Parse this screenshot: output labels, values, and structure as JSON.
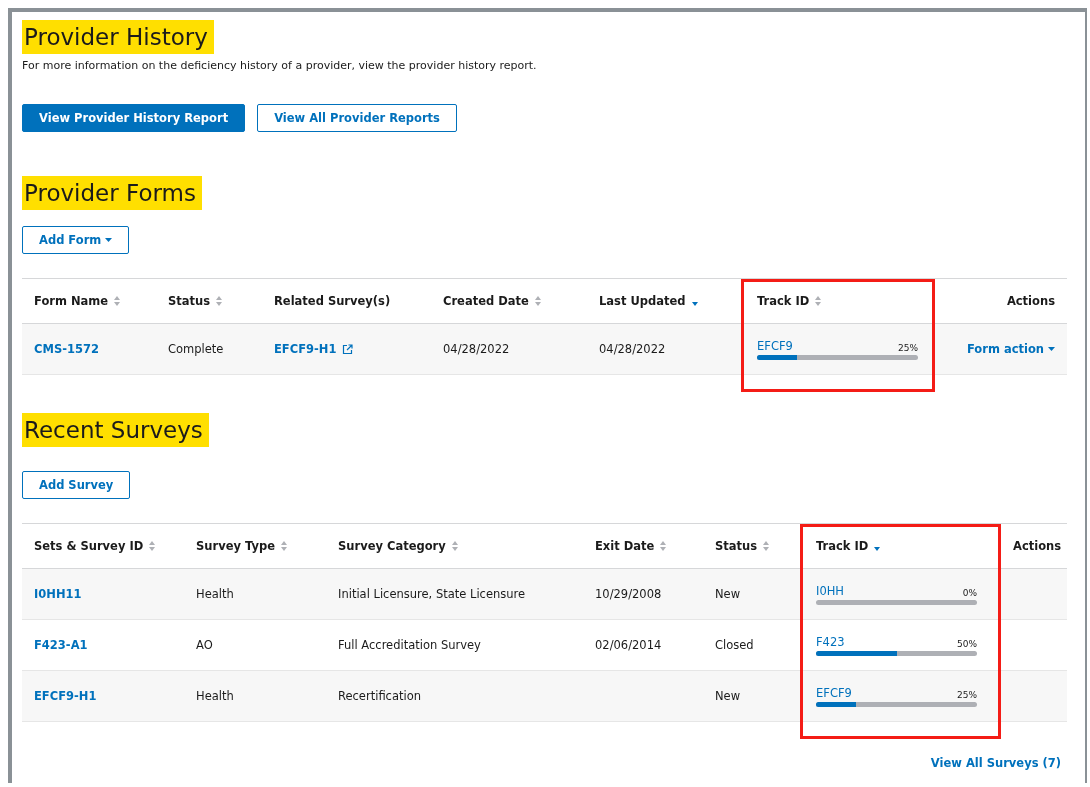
{
  "provider_history": {
    "title": "Provider History",
    "description": "For more information on the deficiency history of a provider, view the provider history report.",
    "buttons": [
      {
        "label": "View Provider History Report",
        "kind": "primary"
      },
      {
        "label": "View All Provider Reports",
        "kind": "outline"
      }
    ]
  },
  "provider_forms": {
    "title": "Provider Forms",
    "add_button": {
      "label": "Add Form",
      "dropdown": true
    },
    "columns": [
      {
        "label": "Form Name",
        "sortable": true,
        "sorted_descending": false,
        "highlighted": false
      },
      {
        "label": "Status",
        "sortable": true,
        "sorted_descending": false,
        "highlighted": false
      },
      {
        "label": "Related Survey(s)",
        "sortable": false,
        "highlighted": false
      },
      {
        "label": "Created Date",
        "sortable": true,
        "sorted_descending": false,
        "highlighted": false
      },
      {
        "label": "Last Updated",
        "sortable": true,
        "sorted_descending": true,
        "highlighted": false
      },
      {
        "label": "Track ID",
        "sortable": true,
        "sorted_descending": false,
        "highlighted": true
      },
      {
        "label": "Actions",
        "sortable": false,
        "highlighted": false
      }
    ],
    "rows": [
      {
        "form_name": "CMS-1572",
        "status": "Complete",
        "related_survey": "EFCF9-H1",
        "created_date": "04/28/2022",
        "last_updated": "04/28/2022",
        "track_id": "EFCF9",
        "progress": "25%",
        "level": 0.25,
        "action": "Form action"
      }
    ]
  },
  "recent_surveys": {
    "title": "Recent Surveys",
    "add_button": {
      "label": "Add Survey",
      "dropdown": false
    },
    "columns": [
      {
        "label": "Sets & Survey ID",
        "sortable": true,
        "sorted_descending": false,
        "highlighted": false
      },
      {
        "label": "Survey Type",
        "sortable": true,
        "sorted_descending": false,
        "highlighted": false
      },
      {
        "label": "Survey Category",
        "sortable": true,
        "sorted_descending": false,
        "highlighted": false
      },
      {
        "label": "Exit Date",
        "sortable": true,
        "sorted_descending": false,
        "highlighted": false
      },
      {
        "label": "Status",
        "sortable": true,
        "sorted_descending": false,
        "highlighted": false
      },
      {
        "label": "Track ID",
        "sortable": true,
        "sorted_descending": true,
        "highlighted": true
      },
      {
        "label": "Actions",
        "sortable": false,
        "highlighted": false
      }
    ],
    "rows": [
      {
        "survey_id": "I0HH11",
        "survey_type": "Health",
        "survey_category": "Initial Licensure, State Licensure",
        "exit_date": "10/29/2008",
        "status": "New",
        "track_id": "I0HH",
        "progress": "0%"
      },
      {
        "survey_id": "F423-A1",
        "survey_type": "AO",
        "survey_category": "Full Accreditation Survey",
        "exit_date": "02/06/2014",
        "status": "Closed",
        "track_id": "F423",
        "progress": "50%",
        "level": 0.5
      },
      {
        "survey_id": "EFCF9-H1",
        "survey_type": "Health",
        "survey_category": "Recertification",
        "status": "New",
        "track_id": "EFCF9",
        "progress": "25%",
        "level": 0.25
      }
    ],
    "view_all_link": "View All Surveys (7)"
  }
}
